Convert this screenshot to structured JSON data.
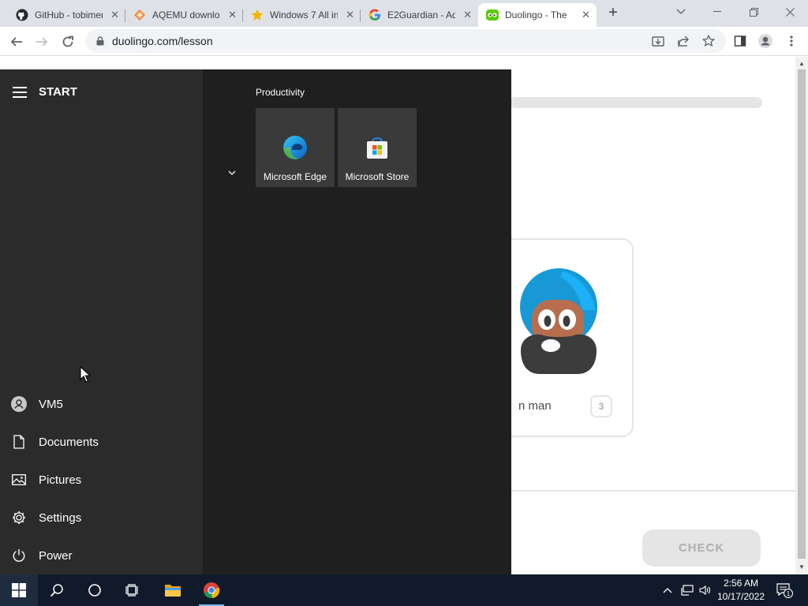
{
  "browser": {
    "tabs": [
      {
        "title": "GitHub - tobimer",
        "icon": "github-icon"
      },
      {
        "title": "AQEMU downloads",
        "icon": "aqemu-icon"
      },
      {
        "title": "Windows 7 All in",
        "icon": "star-icon"
      },
      {
        "title": "E2Guardian - Ad",
        "icon": "google-icon"
      },
      {
        "title": "Duolingo - The",
        "icon": "duolingo-icon",
        "active": true
      }
    ],
    "new_tab": "+",
    "address": "duolingo.com/lesson"
  },
  "lesson": {
    "card_label": "n man",
    "card_number": "3",
    "check_button": "CHECK"
  },
  "start_menu": {
    "header": "START",
    "rail_items": [
      {
        "label": "VM5",
        "icon": "user-avatar-icon"
      },
      {
        "label": "Documents",
        "icon": "document-icon"
      },
      {
        "label": "Pictures",
        "icon": "pictures-icon"
      },
      {
        "label": "Settings",
        "icon": "gear-icon"
      },
      {
        "label": "Power",
        "icon": "power-icon"
      }
    ],
    "group_title": "Productivity",
    "tiles": [
      {
        "label": "Microsoft Edge",
        "icon": "edge-icon"
      },
      {
        "label": "Microsoft Store",
        "icon": "store-icon"
      }
    ]
  },
  "taskbar": {
    "time": "2:56 AM",
    "date": "10/17/2022",
    "notification_count": "1"
  },
  "colors": {
    "start_rail": "#2b2b2b",
    "start_tiles_bg": "#1f1f1f",
    "tile_bg": "#3a3a3a",
    "taskbar": "#101a2a",
    "duolingo_blue": "#1cb0f6",
    "check_disabled": "#e5e5e5"
  }
}
